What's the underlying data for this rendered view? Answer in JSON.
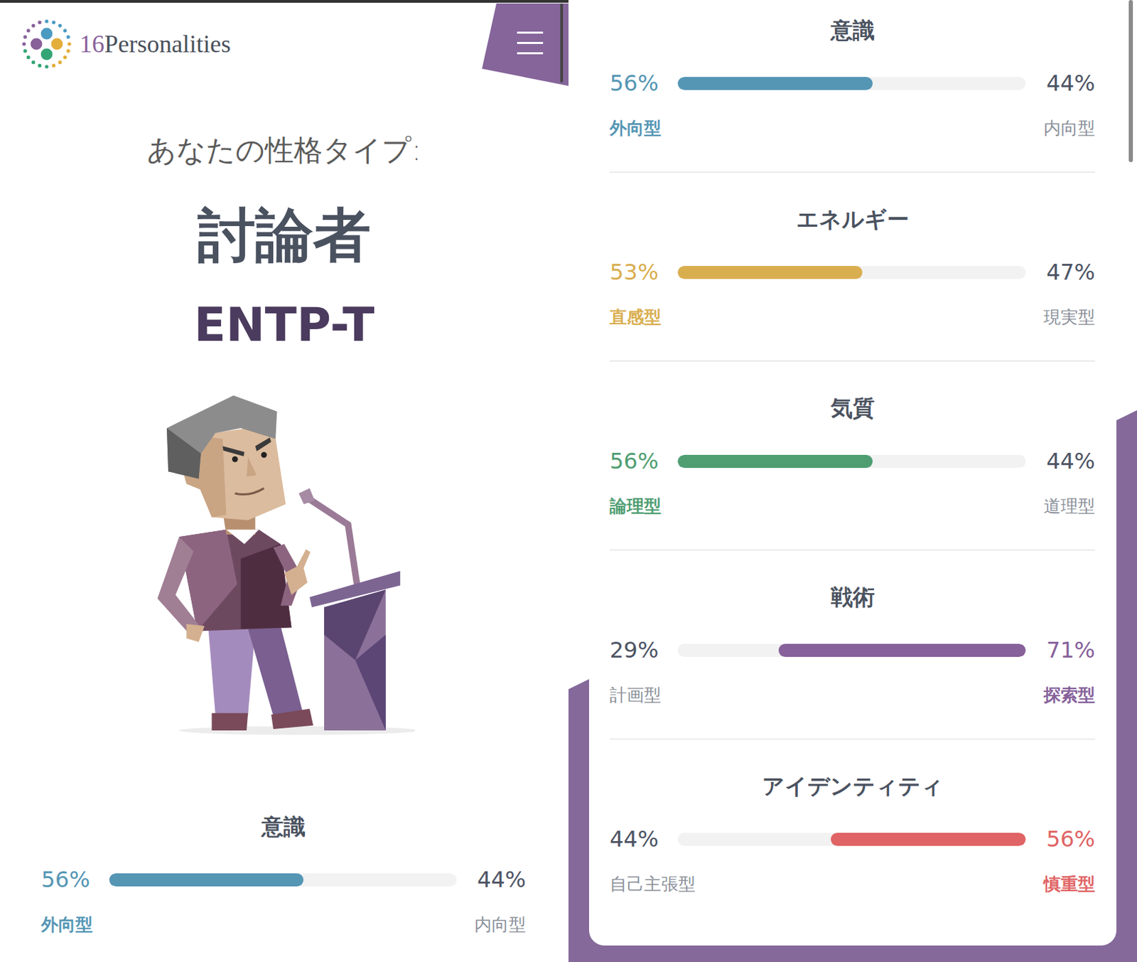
{
  "header": {
    "logo": {
      "number": "16",
      "name": "Personalities"
    }
  },
  "result": {
    "caption": "あなたの性格タイプ:",
    "type_name": "討論者",
    "code": "ENTP-T"
  },
  "preview_traits": [
    {
      "title": "意識",
      "left": {
        "percent": "56%",
        "label": "外向型",
        "selected": true
      },
      "right": {
        "percent": "44%",
        "label": "内向型",
        "selected": false
      },
      "level": 0.56,
      "color": "#5596b5"
    }
  ],
  "traits": [
    {
      "title": "意識",
      "left": {
        "percent": "56%",
        "label": "外向型",
        "selected": true
      },
      "right": {
        "percent": "44%",
        "label": "内向型",
        "selected": false
      },
      "level": 0.56,
      "color": "#5596b5"
    },
    {
      "title": "エネルギー",
      "left": {
        "percent": "53%",
        "label": "直感型",
        "selected": true
      },
      "right": {
        "percent": "47%",
        "label": "現実型",
        "selected": false
      },
      "level": 0.53,
      "color": "#d9ae4f"
    },
    {
      "title": "気質",
      "left": {
        "percent": "56%",
        "label": "論理型",
        "selected": true
      },
      "right": {
        "percent": "44%",
        "label": "道理型",
        "selected": false
      },
      "level": 0.56,
      "color": "#4f9e72"
    },
    {
      "title": "戦術",
      "left": {
        "percent": "29%",
        "label": "計画型",
        "selected": false
      },
      "right": {
        "percent": "71%",
        "label": "探索型",
        "selected": true
      },
      "level": 0.71,
      "color": "#86619a"
    },
    {
      "title": "アイデンティティ",
      "left": {
        "percent": "44%",
        "label": "自己主張型",
        "selected": false
      },
      "right": {
        "percent": "56%",
        "label": "慎重型",
        "selected": true
      },
      "level": 0.56,
      "color": "#e06465"
    }
  ]
}
